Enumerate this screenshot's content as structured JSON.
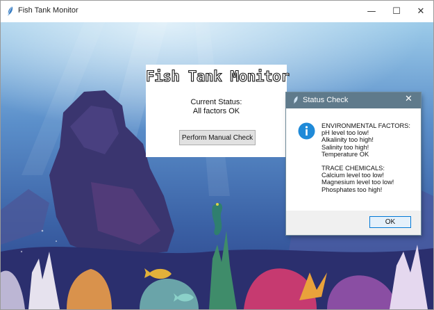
{
  "window": {
    "title": "Fish Tank Monitor",
    "controls": {
      "minimize": "—",
      "maximize": "☐",
      "close": "✕"
    }
  },
  "main": {
    "heading": "Fish Tank Monitor",
    "status_label": "Current Status:",
    "status_value": "All factors OK",
    "check_button": "Perform Manual Check"
  },
  "dialog": {
    "title": "Status Check",
    "close": "✕",
    "icon": "info-icon",
    "environmental": {
      "header": "ENVIRONMENTAL FACTORS:",
      "lines": [
        "pH level too low!",
        "Alkalinity too high!",
        "Salinity too high!",
        "Temperature OK"
      ]
    },
    "trace": {
      "header": "TRACE CHEMICALS:",
      "lines": [
        "Calcium level too low!",
        "Magnesium level too low!",
        "Phosphates too high!"
      ]
    },
    "ok_button": "OK"
  },
  "colors": {
    "dialog_titlebar": "#5f7a8b",
    "info_icon": "#1f8ad8",
    "ok_border": "#0078d7",
    "water_top": "#8fc4e6",
    "water_mid": "#3e6fb0",
    "rock": "#3b3a73",
    "coral_pink": "#d63c7a",
    "coral_orange": "#e8874a"
  }
}
